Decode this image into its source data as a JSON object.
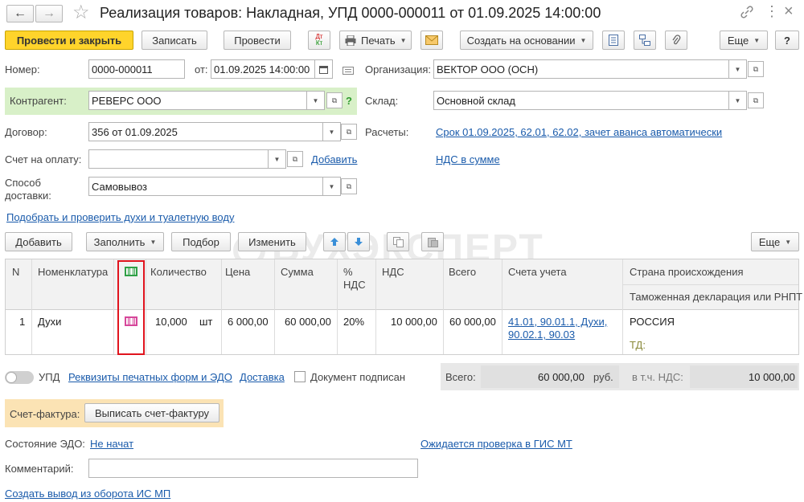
{
  "window": {
    "title": "Реализация товаров: Накладная, УПД 0000-000011 от 01.09.2025 14:00:00"
  },
  "toolbar": {
    "post_close": "Провести и закрыть",
    "save": "Записать",
    "post": "Провести",
    "dt_kt_top": "Дт",
    "dt_kt_bottom": "Кт",
    "print": "Печать",
    "create_based": "Создать на основании",
    "more": "Еще",
    "help": "?"
  },
  "header": {
    "number_label": "Номер:",
    "number_value": "0000-000011",
    "date_label": "от:",
    "date_value": "01.09.2025 14:00:00",
    "org_label": "Организация:",
    "org_value": "ВЕКТОР ООО (ОСН)",
    "counterparty_label": "Контрагент:",
    "counterparty_value": "РЕВЕРС ООО",
    "help_q": "?",
    "warehouse_label": "Склад:",
    "warehouse_value": "Основной склад",
    "contract_label": "Договор:",
    "contract_value": "356 от 01.09.2025",
    "settlements_label": "Расчеты:",
    "settlements_link": "Срок 01.09.2025, 62.01, 62.02, зачет аванса автоматически",
    "invoice_label": "Счет на оплату:",
    "invoice_value": "",
    "add_link": "Добавить",
    "vat_link": "НДС в сумме",
    "delivery_label_1": "Способ",
    "delivery_label_2": "доставки:",
    "delivery_value": "Самовывоз",
    "perfume_link": "Подобрать и проверить духи и туалетную воду"
  },
  "table_toolbar": {
    "add": "Добавить",
    "fill": "Заполнить",
    "select": "Подбор",
    "change": "Изменить",
    "more": "Еще"
  },
  "table": {
    "headers": {
      "n": "N",
      "nomenclature": "Номенклатура",
      "quantity": "Количество",
      "price": "Цена",
      "sum": "Сумма",
      "vat_pct_1": "%",
      "vat_pct_2": "НДС",
      "vat": "НДС",
      "total": "Всего",
      "accounts": "Счета учета",
      "country": "Страна происхождения",
      "customs": "Таможенная декларация или РНПТ"
    },
    "rows": [
      {
        "n": "1",
        "nomenclature": "Духи",
        "quantity": "10,000",
        "unit": "шт",
        "price": "6 000,00",
        "sum": "60 000,00",
        "vat_pct": "20%",
        "vat": "10 000,00",
        "total": "60 000,00",
        "accounts_1": "41.01, 90.01.1, Духи,",
        "accounts_2": "90.02.1, 90.03",
        "country": "РОССИЯ",
        "customs": "ТД:"
      }
    ]
  },
  "footer": {
    "upd_label": "УПД",
    "print_forms_link": "Реквизиты печатных форм и ЭДО",
    "delivery_link": "Доставка",
    "signed_label": "Документ подписан",
    "total_label": "Всего:",
    "total_value": "60 000,00",
    "currency": "руб.",
    "vat_incl_label": "в т.ч. НДС:",
    "vat_incl_value": "10 000,00",
    "invoice_doc_label": "Счет-фактура:",
    "invoice_doc_button": "Выписать счет-фактуру",
    "edo_label": "Состояние ЭДО:",
    "edo_link": "Не начат",
    "gis_link": "Ожидается проверка в ГИС МТ",
    "comment_label": "Комментарий:",
    "comment_value": "",
    "create_output_link": "Создать вывод из оборота ИС МП"
  },
  "watermark": "БУХЭКСПЕРТ",
  "colors": {
    "primary_button": "#ffd42b",
    "link": "#1a5bab",
    "highlight_border": "#e0141e",
    "counterparty_bg": "#d8f0c8",
    "invoice_bg": "#fbe3b4",
    "totals_bg": "#e8e8e8"
  }
}
